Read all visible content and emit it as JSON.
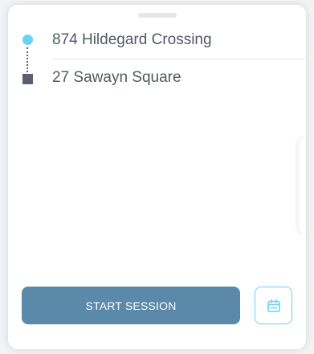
{
  "route": {
    "origin": "874 Hildegard Crossing",
    "destination": "27 Sawayn Square"
  },
  "actions": {
    "start_label": "START SESSION",
    "calendar_icon": "calendar-icon"
  },
  "colors": {
    "origin_marker": "#69d4f2",
    "destination_marker": "#5b6070",
    "primary_button": "#5a89aa",
    "calendar_border": "#69d4f2"
  }
}
